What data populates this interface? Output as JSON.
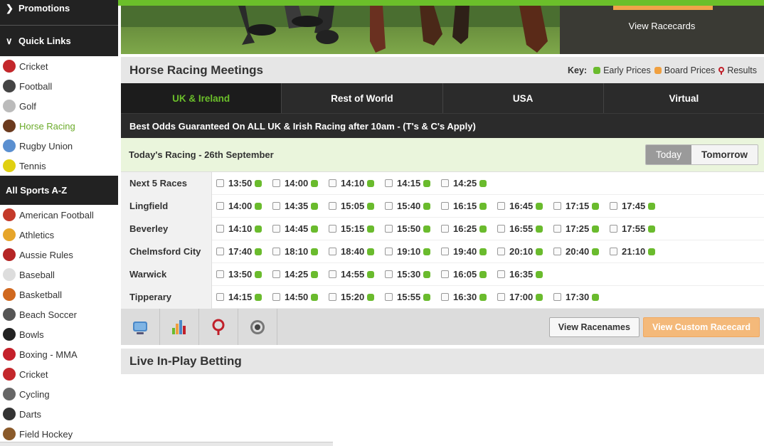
{
  "sidebar": {
    "promotions_label": "Promotions",
    "quick_links_label": "Quick Links",
    "quick_links": [
      {
        "label": "Cricket",
        "icon": "cricket-ball-icon",
        "color": "#c3272b"
      },
      {
        "label": "Football",
        "icon": "football-icon",
        "color": "#444444"
      },
      {
        "label": "Golf",
        "icon": "golf-icon",
        "color": "#bbbbbb"
      },
      {
        "label": "Horse Racing",
        "icon": "horse-icon",
        "color": "#6b3a1e",
        "active": true
      },
      {
        "label": "Rugby Union",
        "icon": "rugby-ball-icon",
        "color": "#5a8fd0"
      },
      {
        "label": "Tennis",
        "icon": "tennis-ball-icon",
        "color": "#e0d010"
      }
    ],
    "all_sports_label": "All Sports A-Z",
    "all_sports": [
      {
        "label": "American Football",
        "icon": "american-football-icon",
        "color": "#c43a2a"
      },
      {
        "label": "Athletics",
        "icon": "medal-icon",
        "color": "#e6a52a"
      },
      {
        "label": "Aussie Rules",
        "icon": "aussie-rules-ball-icon",
        "color": "#b52525"
      },
      {
        "label": "Baseball",
        "icon": "baseball-icon",
        "color": "#dddddd"
      },
      {
        "label": "Basketball",
        "icon": "basketball-icon",
        "color": "#d0681e"
      },
      {
        "label": "Beach Soccer",
        "icon": "beach-soccer-icon",
        "color": "#555555"
      },
      {
        "label": "Bowls",
        "icon": "bowls-icon",
        "color": "#222222"
      },
      {
        "label": "Boxing - MMA",
        "icon": "boxing-glove-icon",
        "color": "#c4202a"
      },
      {
        "label": "Cricket",
        "icon": "cricket-ball-icon",
        "color": "#c3272b"
      },
      {
        "label": "Cycling",
        "icon": "cycling-icon",
        "color": "#666666"
      },
      {
        "label": "Darts",
        "icon": "dartboard-icon",
        "color": "#333333"
      },
      {
        "label": "Field Hockey",
        "icon": "hockey-stick-icon",
        "color": "#8a5a2a"
      }
    ]
  },
  "hero": {
    "side_link": "View Racecards",
    "accent": "#f0a44a"
  },
  "meetings": {
    "title": "Horse Racing Meetings",
    "key_label": "Key:",
    "key_items": [
      "Early Prices",
      "Board Prices",
      "Results"
    ],
    "tabs": [
      "UK & Ireland",
      "Rest of World",
      "USA",
      "Virtual"
    ],
    "active_tab": "UK & Ireland",
    "promo_text": "Best Odds Guaranteed On ALL UK & Irish Racing after 10am - (T's & C's Apply)",
    "day_title": "Today's Racing - 26th September",
    "today_label": "Today",
    "tomorrow_label": "Tomorrow",
    "rows": [
      {
        "name": "Next 5 Races",
        "times": [
          "13:50",
          "14:00",
          "14:10",
          "14:15",
          "14:25"
        ]
      },
      {
        "name": "Lingfield",
        "times": [
          "14:00",
          "14:35",
          "15:05",
          "15:40",
          "16:15",
          "16:45",
          "17:15",
          "17:45"
        ]
      },
      {
        "name": "Beverley",
        "times": [
          "14:10",
          "14:45",
          "15:15",
          "15:50",
          "16:25",
          "16:55",
          "17:25",
          "17:55"
        ]
      },
      {
        "name": "Chelmsford City",
        "times": [
          "17:40",
          "18:10",
          "18:40",
          "19:10",
          "19:40",
          "20:10",
          "20:40",
          "21:10"
        ]
      },
      {
        "name": "Warwick",
        "times": [
          "13:50",
          "14:25",
          "14:55",
          "15:30",
          "16:05",
          "16:35"
        ]
      },
      {
        "name": "Tipperary",
        "times": [
          "14:15",
          "14:50",
          "15:20",
          "15:55",
          "16:30",
          "17:00",
          "17:30"
        ]
      }
    ],
    "toolbar_icons": [
      "tv-icon",
      "bar-chart-icon",
      "location-pin-icon",
      "camera-lens-icon"
    ],
    "view_racenames_label": "View Racenames",
    "view_custom_label": "View Custom Racecard",
    "colors": {
      "early_price": "#6abb2d",
      "board_price": "#f0a040",
      "result": "#c0202a",
      "active_tab": "#6bbf2a"
    }
  },
  "live": {
    "title": "Live In-Play Betting"
  }
}
